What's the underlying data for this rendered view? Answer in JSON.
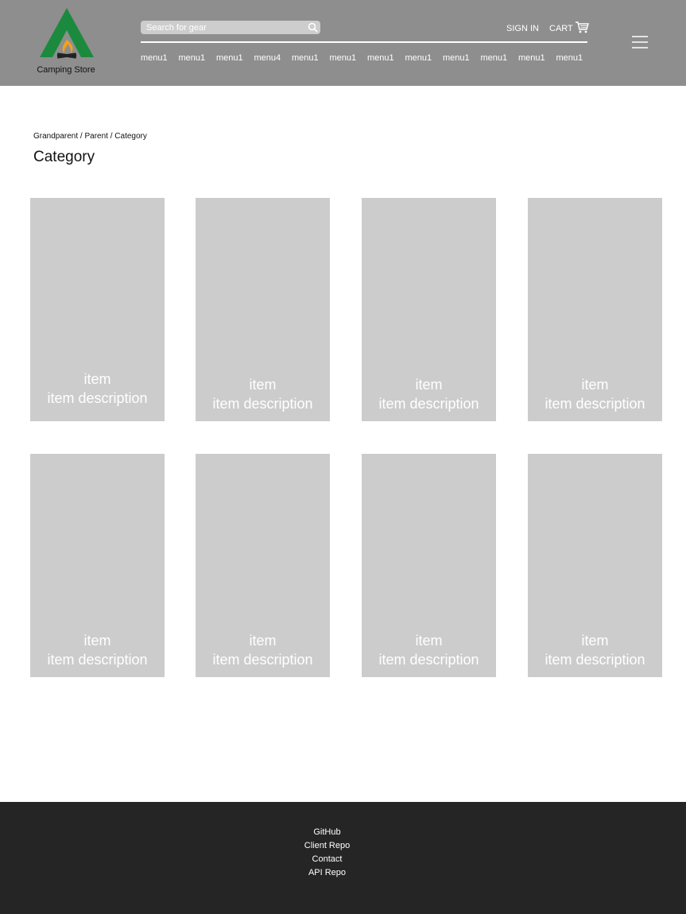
{
  "header": {
    "logo_text": "Camping Store",
    "search_placeholder": "Search for gear",
    "sign_in": "SIGN IN",
    "cart": "CART",
    "menus": [
      "menu1",
      "menu1",
      "menu1",
      "menu4",
      "menu1",
      "menu1",
      "menu1",
      "menu1",
      "menu1",
      "menu1",
      "menu1",
      "menu1"
    ]
  },
  "breadcrumb": "Grandparent / Parent / Category",
  "title": "Category",
  "items": [
    {
      "name": "item",
      "description": "item description"
    },
    {
      "name": "item",
      "description": "item description"
    },
    {
      "name": "item",
      "description": "item description"
    },
    {
      "name": "item",
      "description": "item description"
    },
    {
      "name": "item",
      "description": "item description"
    },
    {
      "name": "item",
      "description": "item description"
    },
    {
      "name": "item",
      "description": "item description"
    },
    {
      "name": "item",
      "description": "item description"
    }
  ],
  "footer": {
    "links": [
      "GitHub",
      "Client Repo",
      "Contact",
      "API Repo"
    ]
  },
  "colors": {
    "header_bg": "#8e8e8e",
    "card_bg": "#cccccc",
    "footer_bg": "#252525",
    "logo_green": "#1b8a3e"
  }
}
